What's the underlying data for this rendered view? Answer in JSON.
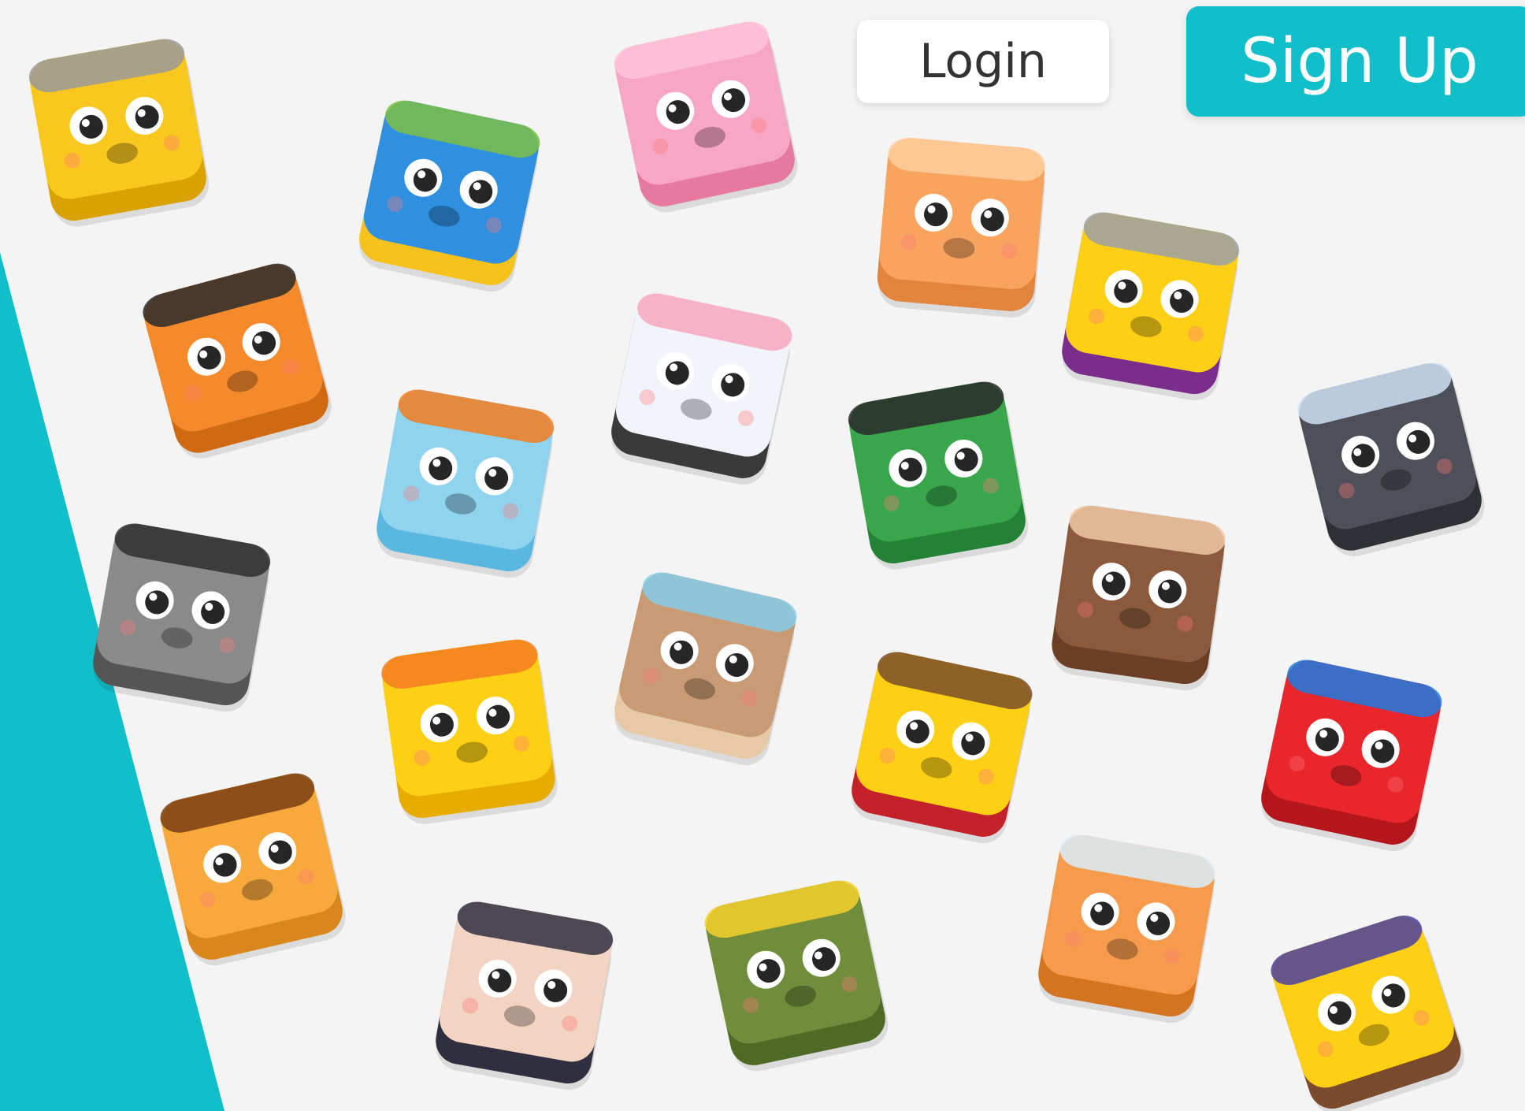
{
  "header": {
    "login_label": "Login",
    "signup_label": "Sign Up"
  },
  "colors": {
    "accent": "#11bfcb",
    "background": "#f4f4f4",
    "login_text": "#333333"
  },
  "avatars": [
    {
      "icon": "king-chick-icon",
      "color": "#f9c81e",
      "shade": "#d9a200",
      "accent": "#9a9a9a"
    },
    {
      "icon": "tiger-icon",
      "color": "#f58a2c",
      "shade": "#cf6a12",
      "accent": "#2a2a2a"
    },
    {
      "icon": "raccoon-icon",
      "color": "#8a8a8a",
      "shade": "#555555",
      "accent": "#2e2e2e"
    },
    {
      "icon": "leopard-icon",
      "color": "#f8a93c",
      "shade": "#d9861a",
      "accent": "#7a3f10"
    },
    {
      "icon": "macaw-blue-yellow-icon",
      "color": "#2f8fe0",
      "shade": "#f6c21b",
      "accent": "#7bc043"
    },
    {
      "icon": "goldfish-jar-icon",
      "color": "#8fd3ef",
      "shade": "#5ab8e0",
      "accent": "#f37c1f"
    },
    {
      "icon": "duckling-icon",
      "color": "#fdd016",
      "shade": "#e8ac00",
      "accent": "#f37c1f"
    },
    {
      "icon": "sloth-icon",
      "color": "#f3d3c2",
      "shade": "#2f2f3f",
      "accent": "#2f2f3f"
    },
    {
      "icon": "pig-icon",
      "color": "#f8a6c5",
      "shade": "#e5799f",
      "accent": "#ffc2d8"
    },
    {
      "icon": "cow-icon",
      "color": "#f1f4fb",
      "shade": "#3a3a3a",
      "accent": "#f7a6bd"
    },
    {
      "icon": "hamster-icon",
      "color": "#c99b74",
      "shade": "#e7c9a6",
      "accent": "#86cde9"
    },
    {
      "icon": "snake-icon",
      "color": "#6f8d3a",
      "shade": "#4e6a24",
      "accent": "#f6d12b"
    },
    {
      "icon": "cat-icon",
      "color": "#f8a45f",
      "shade": "#e3843c",
      "accent": "#ffcf9e"
    },
    {
      "icon": "crocodile-icon",
      "color": "#3aa64c",
      "shade": "#238236",
      "accent": "#2a2a2a"
    },
    {
      "icon": "jester-chick-icon",
      "color": "#fdd016",
      "shade": "#c4222a",
      "accent": "#7a4f2a"
    },
    {
      "icon": "fox-icon",
      "color": "#f69b4c",
      "shade": "#d47420",
      "accent": "#d8eefa"
    },
    {
      "icon": "queen-chick-icon",
      "color": "#fdd016",
      "shade": "#7a2d8a",
      "accent": "#9aa0a6"
    },
    {
      "icon": "dog-icon",
      "color": "#8b5a3c",
      "shade": "#6a3f25",
      "accent": "#f0c9a6"
    },
    {
      "icon": "penguin-icon",
      "color": "#4d5058",
      "shade": "#2e3036",
      "accent": "#cfe0f5"
    },
    {
      "icon": "red-macaw-icon",
      "color": "#e8262c",
      "shade": "#b5161b",
      "accent": "#1f7be0"
    },
    {
      "icon": "wizard-chick-icon",
      "color": "#fdd016",
      "shade": "#7a4a2c",
      "accent": "#4a3fa0"
    }
  ]
}
